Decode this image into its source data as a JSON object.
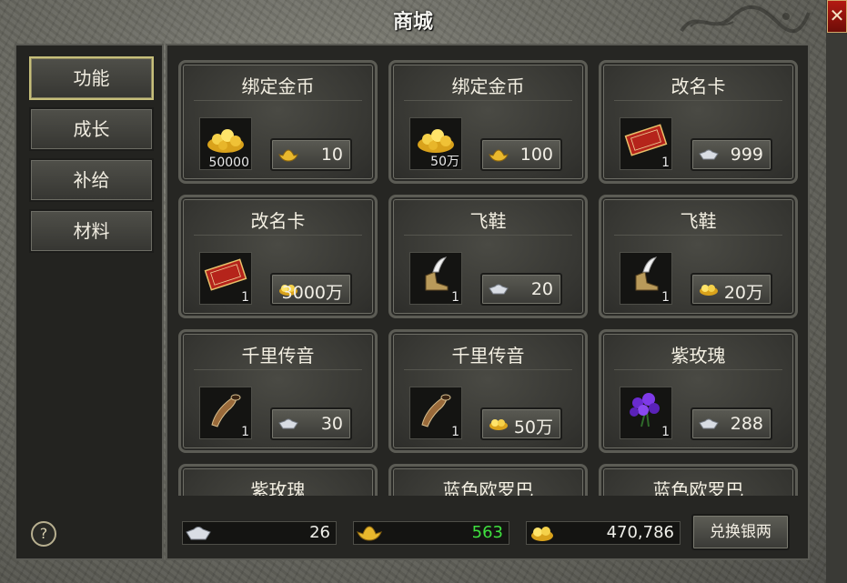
{
  "window": {
    "title": "商城",
    "close_label": "✕"
  },
  "sidebar": {
    "items": [
      {
        "label": "功能",
        "active": true
      },
      {
        "label": "成长",
        "active": false
      },
      {
        "label": "补给",
        "active": false
      },
      {
        "label": "材料",
        "active": false
      }
    ],
    "help_label": "?"
  },
  "shop": {
    "items": [
      {
        "name": "绑定金币",
        "icon": "gold-coins-icon",
        "qty": "50000",
        "currency": "gold-ingot-icon",
        "price": "10"
      },
      {
        "name": "绑定金币",
        "icon": "gold-coins-icon",
        "qty": "50万",
        "currency": "gold-ingot-icon",
        "price": "100"
      },
      {
        "name": "改名卡",
        "icon": "rename-card-icon",
        "qty": "1",
        "currency": "silver-ingot-icon",
        "price": "999"
      },
      {
        "name": "改名卡",
        "icon": "rename-card-icon",
        "qty": "1",
        "currency": "gold-coins-icon",
        "price": "3000万"
      },
      {
        "name": "飞鞋",
        "icon": "flying-shoe-icon",
        "qty": "1",
        "currency": "silver-ingot-icon",
        "price": "20"
      },
      {
        "name": "飞鞋",
        "icon": "flying-shoe-icon",
        "qty": "1",
        "currency": "gold-coins-icon",
        "price": "20万"
      },
      {
        "name": "千里传音",
        "icon": "horn-icon",
        "qty": "1",
        "currency": "silver-ingot-icon",
        "price": "30"
      },
      {
        "name": "千里传音",
        "icon": "horn-icon",
        "qty": "1",
        "currency": "gold-coins-icon",
        "price": "50万"
      },
      {
        "name": "紫玫瑰",
        "icon": "purple-rose-icon",
        "qty": "1",
        "currency": "silver-ingot-icon",
        "price": "288"
      },
      {
        "name": "紫玫瑰",
        "icon": "purple-rose-icon",
        "qty": "",
        "currency": "",
        "price": ""
      },
      {
        "name": "蓝色欧罗巴",
        "icon": "",
        "qty": "",
        "currency": "",
        "price": ""
      },
      {
        "name": "蓝色欧罗巴",
        "icon": "",
        "qty": "",
        "currency": "",
        "price": ""
      }
    ]
  },
  "resources": {
    "silver": {
      "icon": "silver-ingot-icon",
      "value": "26",
      "color": "#f0f0ea"
    },
    "gold_ingot": {
      "icon": "gold-ingot-icon",
      "value": "563",
      "color": "#3fe03f"
    },
    "gold_coins": {
      "icon": "gold-coins-icon",
      "value": "470,786",
      "color": "#f0f0ea"
    }
  },
  "exchange_label": "兑换银两"
}
